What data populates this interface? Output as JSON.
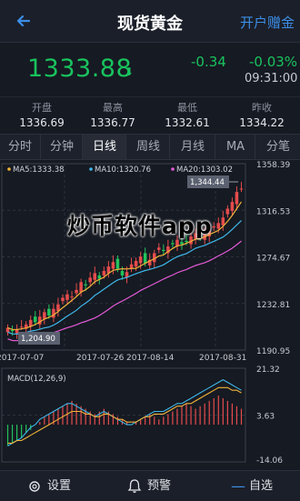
{
  "header": {
    "title": "现货黄金",
    "open_account_label": "开户赠金"
  },
  "quote": {
    "price": "1333.88",
    "change": "-0.34",
    "change_pct": "-0.03%",
    "time": "09:31:00",
    "direction_arrow": "⬇"
  },
  "stats": [
    {
      "label": "开盘",
      "value": "1336.69"
    },
    {
      "label": "最高",
      "value": "1336.77"
    },
    {
      "label": "最低",
      "value": "1332.61"
    },
    {
      "label": "昨收",
      "value": "1334.22"
    }
  ],
  "tabs": [
    {
      "label": "分时"
    },
    {
      "label": "分钟"
    },
    {
      "label": "日线"
    },
    {
      "label": "周线"
    },
    {
      "label": "月线"
    },
    {
      "label": "MA"
    },
    {
      "label": "分笔"
    }
  ],
  "active_tab_index": 2,
  "chart_data": {
    "type": "candlestick",
    "legend": [
      {
        "label": "MA5:1333.38",
        "color": "#f0b33a"
      },
      {
        "label": "MA10:1320.76",
        "color": "#3fb7e9"
      },
      {
        "label": "MA20:1303.02",
        "color": "#e45ad9"
      }
    ],
    "y_ticks": [
      "1358.39",
      "1316.53",
      "1274.67",
      "1232.81",
      "1190.95"
    ],
    "x_ticks": [
      "2017-07-07",
      "2017-07-26",
      "2017-08-14",
      "2017-08-31"
    ],
    "ylim": [
      1190.95,
      1358.39
    ],
    "annotations": {
      "high": "1,344.44",
      "low": "1,204.90"
    },
    "closes": [
      1211,
      1208,
      1209,
      1212,
      1214,
      1218,
      1216,
      1221,
      1225,
      1222,
      1228,
      1232,
      1238,
      1241,
      1239,
      1245,
      1252,
      1249,
      1256,
      1260,
      1255,
      1262,
      1266,
      1270,
      1264,
      1258,
      1261,
      1268,
      1271,
      1275,
      1269,
      1272,
      1278,
      1283,
      1280,
      1284,
      1286,
      1290,
      1286,
      1288,
      1293,
      1296,
      1292,
      1295,
      1298,
      1302,
      1305,
      1310,
      1318,
      1324,
      1333,
      1336
    ],
    "colors": {
      "up": "#e54c4c",
      "down": "#23c25c"
    },
    "macd": {
      "label": "MACD(12,26,9)",
      "y_ticks": [
        "21.32",
        "3.63",
        "-14.06"
      ],
      "ylim": [
        -14.06,
        21.32
      ],
      "hist": [
        -8,
        -7,
        -6,
        -5,
        -3,
        -2,
        0,
        1,
        3,
        4,
        5,
        6,
        7,
        8,
        9,
        8,
        7,
        6,
        5,
        4,
        5,
        6,
        5,
        4,
        3,
        2,
        1,
        0,
        1,
        2,
        3,
        4,
        3,
        2,
        3,
        4,
        5,
        6,
        7,
        8,
        7,
        6,
        7,
        8,
        9,
        10,
        11,
        10,
        9,
        8,
        7,
        6
      ],
      "dif": [
        -8,
        -7,
        -6,
        -5,
        -3,
        -1,
        0,
        2,
        3,
        4,
        5,
        6,
        7,
        8,
        8,
        7,
        6,
        5,
        4,
        3,
        4,
        5,
        4,
        3,
        2,
        1,
        0,
        0,
        1,
        2,
        3,
        4,
        5,
        5,
        5,
        6,
        7,
        8,
        8,
        9,
        10,
        11,
        12,
        13,
        14,
        15,
        16,
        17,
        16,
        15,
        14,
        13
      ],
      "dea": [
        -7,
        -7,
        -6,
        -6,
        -5,
        -4,
        -3,
        -2,
        -1,
        0,
        1,
        2,
        3,
        4,
        5,
        5,
        5,
        4,
        4,
        3,
        3,
        4,
        4,
        3,
        2,
        2,
        1,
        1,
        1,
        2,
        3,
        3,
        4,
        4,
        4,
        5,
        6,
        7,
        7,
        8,
        8,
        9,
        10,
        11,
        12,
        13,
        14,
        14,
        14,
        13,
        13,
        12
      ]
    }
  },
  "watermark": "炒币软件app",
  "bottom_bar": {
    "settings_label": "设置",
    "alert_label": "预警",
    "watchlist_label": "自选"
  }
}
